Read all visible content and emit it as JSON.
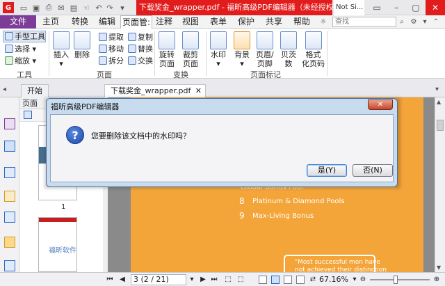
{
  "titlebar": {
    "doc_title": "下载奖金_wrapper.pdf - 福昕高级PDF编辑器（未经授权的产品）",
    "sign_in": "Not Si..."
  },
  "menu": {
    "items": [
      "文件",
      "主页",
      "转换",
      "编辑",
      "页面管:",
      "注释",
      "视图",
      "表单",
      "保护",
      "共享",
      "帮助"
    ],
    "search_placeholder": "查找"
  },
  "ribbon": {
    "tools": {
      "hand": "手型工具",
      "select": "选择",
      "zoom": "缩放",
      "group": "工具"
    },
    "page": {
      "insert": "插入",
      "delete": "删除",
      "extract": "提取",
      "move": "移动",
      "split": "拆分",
      "copy": "复制",
      "replace": "替换",
      "swap": "交换",
      "group": "页面"
    },
    "transform": {
      "rotate": "旋转\n页面",
      "crop": "裁剪\n页面",
      "group": "变换"
    },
    "marks": {
      "watermark": "水印",
      "background": "背景",
      "header_footer": "页眉/\n页脚",
      "bates": "贝茨\n数",
      "format": "格式\n化页码",
      "group": "页面标记"
    }
  },
  "tabs": {
    "start": "开始",
    "document": "下载奖金_wrapper.pdf"
  },
  "panel": {
    "title": "页面",
    "thumb1_label": "1",
    "thumb2_caption": "福昕软件"
  },
  "pdf": {
    "line1": "Global Bonus Pool",
    "line2_num": "8",
    "line2": "Platinum & Diamond Pools",
    "line3_num": "9",
    "line3": "Max-Living Bonus",
    "quote1": "\"Most successful men have",
    "quote2": "not achieved their distinction"
  },
  "status": {
    "page": "3 (2 / 21)",
    "zoom": "67.16%"
  },
  "dialog": {
    "title": "福昕高级PDF编辑器",
    "message": "您要删除该文档中的水印吗？",
    "yes": "是(Y)",
    "no": "否(N)",
    "icon": "question-icon"
  }
}
